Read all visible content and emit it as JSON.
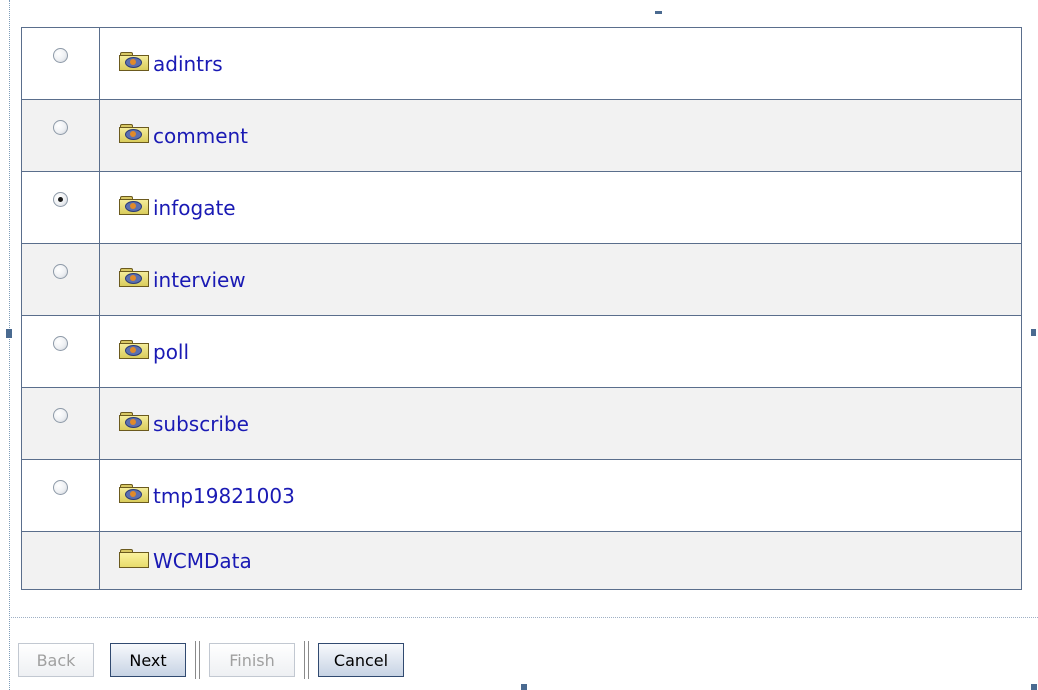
{
  "folders": [
    {
      "name": "adintrs",
      "selected": false,
      "has_radio": true,
      "icon": "shared-folder-icon"
    },
    {
      "name": "comment",
      "selected": false,
      "has_radio": true,
      "icon": "shared-folder-icon"
    },
    {
      "name": "infogate",
      "selected": true,
      "has_radio": true,
      "icon": "shared-folder-icon"
    },
    {
      "name": "interview",
      "selected": false,
      "has_radio": true,
      "icon": "shared-folder-icon"
    },
    {
      "name": "poll",
      "selected": false,
      "has_radio": true,
      "icon": "shared-folder-icon"
    },
    {
      "name": "subscribe",
      "selected": false,
      "has_radio": true,
      "icon": "shared-folder-icon"
    },
    {
      "name": "tmp19821003",
      "selected": false,
      "has_radio": true,
      "icon": "shared-folder-icon"
    },
    {
      "name": "WCMData",
      "selected": false,
      "has_radio": false,
      "icon": "folder-icon"
    }
  ],
  "buttons": {
    "back": {
      "label": "Back",
      "enabled": false
    },
    "next": {
      "label": "Next",
      "enabled": true
    },
    "finish": {
      "label": "Finish",
      "enabled": false
    },
    "cancel": {
      "label": "Cancel",
      "enabled": true
    }
  },
  "colors": {
    "link": "#1a1ab4",
    "table_border": "#5a6e8c",
    "alt_row": "#f2f2f2"
  }
}
